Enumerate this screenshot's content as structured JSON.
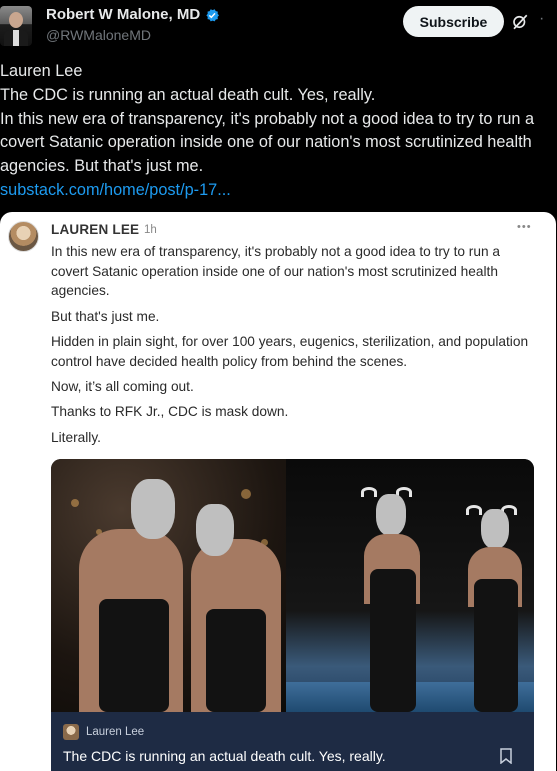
{
  "tweet": {
    "author_name": "Robert W Malone, MD",
    "author_handle": "@RWMaloneMD",
    "subscribe_label": "Subscribe",
    "lines": [
      "Lauren Lee",
      "The CDC is running an actual death cult. Yes, really.",
      "In this new era of transparency, it's probably not a good idea to try to run a covert Satanic operation inside one of our nation's most scrutinized health agencies. But that's just me."
    ],
    "link_text": "substack.com/home/post/p-17...",
    "icons": [
      "verified-badge-icon",
      "grok-icon",
      "more-icon"
    ],
    "accent_color": "#1d9bf0"
  },
  "quote_card": {
    "author_name": "LAUREN LEE",
    "time": "1h",
    "paragraphs": [
      "In this new era of transparency, it's probably not a good idea to try to run a covert Satanic operation inside one of our nation's most scrutinized health agencies.",
      "But that's just me.",
      "Hidden in plain sight, for over 100 years, eugenics, sterilization, and population control have decided health policy from behind the scenes.",
      "Now, it’s all coming out.",
      "Thanks to RFK Jr., CDC is mask down.",
      "Literally."
    ],
    "media": {
      "caption_author": "Lauren Lee",
      "caption_title": "The CDC is running an actual death cult. Yes, really.",
      "icons": [
        "bookmark-icon"
      ],
      "caption_bar_color": "#1e2b44"
    }
  }
}
